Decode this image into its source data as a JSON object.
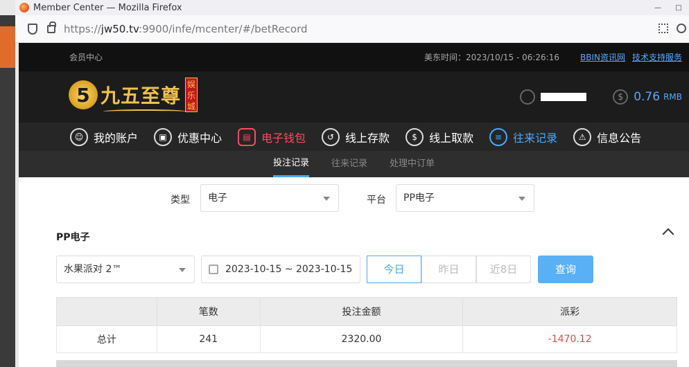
{
  "browser": {
    "window_title": "Member Center — Mozilla Firefox",
    "url_prefix": "https://",
    "url_host": "jw50.tv",
    "url_rest": ":9900/infe/mcenter/#/betRecord"
  },
  "topbar": {
    "member_center": "会员中心",
    "time": "美东时间：2023/10/15 - 06:26:16",
    "link_bbin": "BBIN资讯网",
    "link_support": "技术支持服务"
  },
  "header": {
    "logo_letter": "5",
    "logo_text": "九五至尊",
    "logo_badge": "娱乐城",
    "balance": "0.76",
    "balance_unit": "RMB"
  },
  "nav": [
    {
      "label": "我的账户",
      "icon": "user-icon"
    },
    {
      "label": "优惠中心",
      "icon": "gift-icon"
    },
    {
      "label": "电子钱包",
      "icon": "wallet-icon"
    },
    {
      "label": "线上存款",
      "icon": "deposit-icon"
    },
    {
      "label": "线上取款",
      "icon": "withdraw-icon"
    },
    {
      "label": "往来记录",
      "icon": "record-icon"
    },
    {
      "label": "信息公告",
      "icon": "bell-icon"
    }
  ],
  "subnav": [
    "投注记录",
    "往来记录",
    "处理中订单"
  ],
  "filters": {
    "type_label": "类型",
    "type_value": "电子",
    "platform_label": "平台",
    "platform_value": "PP电子"
  },
  "section_title": "PP电子",
  "query": {
    "game": "水果派对 2™",
    "date_range": "2023-10-15 ~ 2023-10-15",
    "btn_today": "今日",
    "btn_yesterday": "昨日",
    "btn_8days": "近8日",
    "btn_query": "查询"
  },
  "summary": {
    "headers": [
      "",
      "笔数",
      "投注金额",
      "派彩"
    ],
    "row": [
      "总计",
      "241",
      "2320.00",
      "-1470.12"
    ]
  },
  "colors": {
    "accent": "#4aa8ff",
    "danger": "#e04a4a",
    "gold": "#f2c14b"
  }
}
